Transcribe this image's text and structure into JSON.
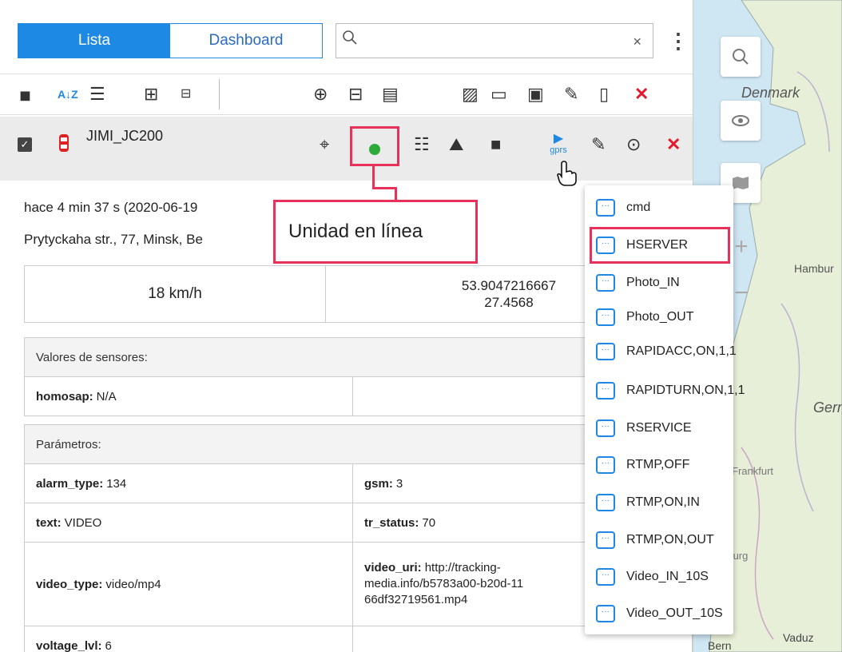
{
  "tabs": {
    "lista": "Lista",
    "dashboard": "Dashboard"
  },
  "search": {
    "placeholder": "",
    "clear": "×"
  },
  "toolbar": {
    "sort_icon": "A↓Z",
    "close_label": "✕"
  },
  "unit": {
    "name": "JIMI_JC200",
    "last_update": "hace 4 min 37 s (2020-06-19",
    "address": "Prytyckaha str., 77, Minsk, Be",
    "speed": "18 km/h",
    "lat": "53.9047216667",
    "lon": "27.4568",
    "gprs_label": "gprs"
  },
  "tooltip": "Unidad en línea",
  "sensors": {
    "header": "Valores de sensores:",
    "rows": [
      {
        "key": "homosap:",
        "value": "N/A"
      }
    ]
  },
  "params": {
    "header": "Parámetros:",
    "alarm_type": {
      "key": "alarm_type:",
      "value": "134"
    },
    "gsm": {
      "key": "gsm:",
      "value": "3"
    },
    "text": {
      "key": "text:",
      "value": "VIDEO"
    },
    "tr_status": {
      "key": "tr_status:",
      "value": "70"
    },
    "video_type": {
      "key": "video_type:",
      "value": "video/mp4"
    },
    "video_uri_key": "video_uri:",
    "video_uri_l1": "http://tracking-",
    "video_uri_l2": "media.info/b5783a00-b20d-11",
    "video_uri_l3": "66df32719561.mp4",
    "voltage": {
      "key": "voltage_lvl:",
      "value": "6"
    }
  },
  "commands": [
    "cmd",
    "HSERVER",
    "Photo_IN",
    "Photo_OUT",
    "RAPIDACC,ON,1,1",
    "RAPIDTURN,ON,1,1",
    "RSERVICE",
    "RTMP,OFF",
    "RTMP,ON,IN",
    "RTMP,ON,OUT",
    "Video_IN_10S",
    "Video_OUT_10S"
  ],
  "map": {
    "labels": [
      "Denmark",
      "Hambur",
      "Germ",
      "Frankfurt",
      "Strasburg",
      "Bern",
      "Vaduz"
    ]
  },
  "colors": {
    "accent": "#1e88e5",
    "highlight": "#e8315a",
    "online": "#2eaa3b",
    "danger": "#e3192d"
  }
}
